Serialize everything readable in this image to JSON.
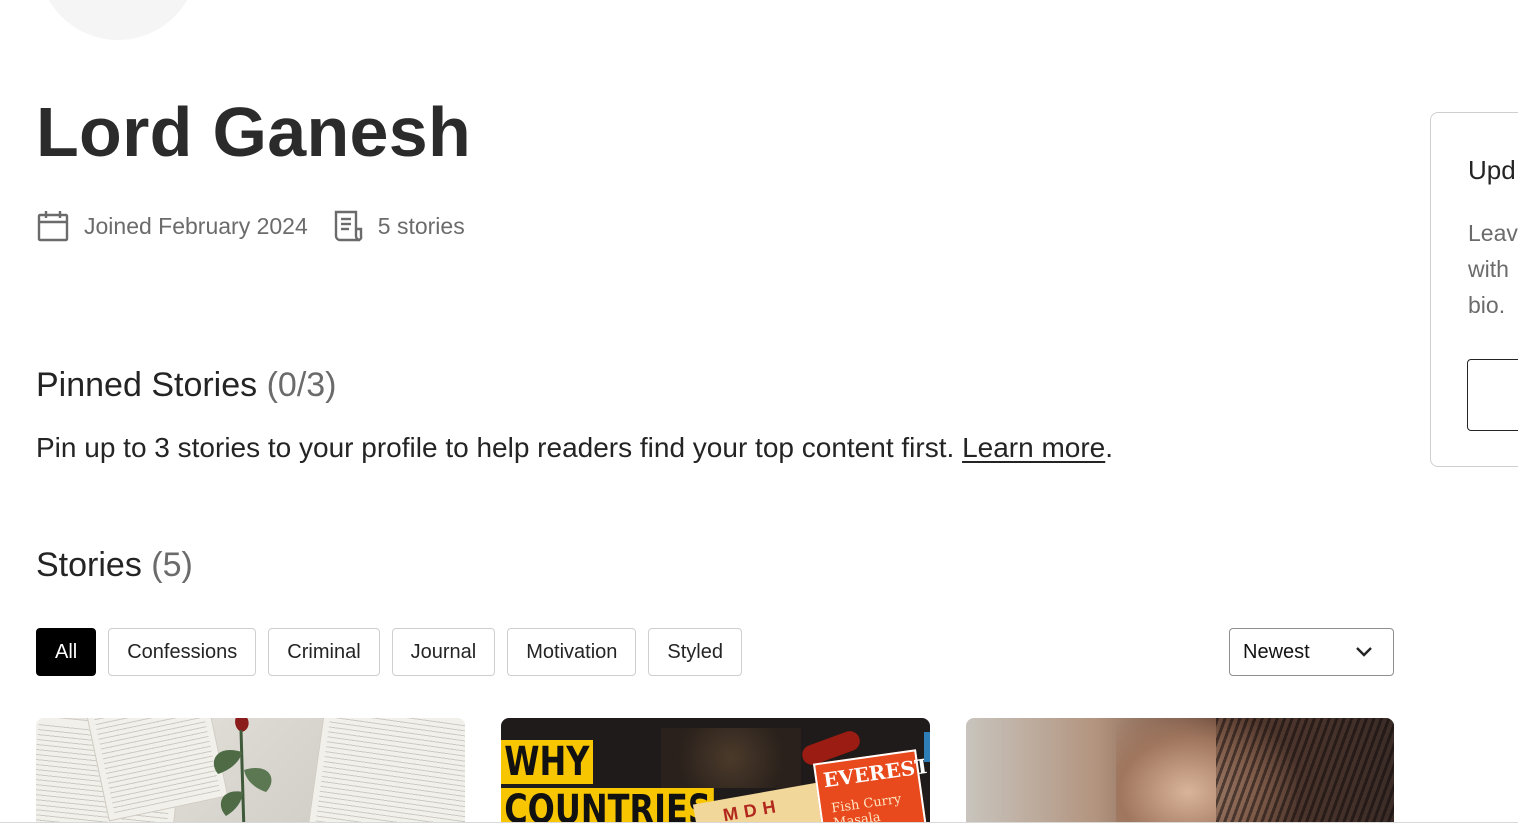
{
  "profile": {
    "name": "Lord Ganesh",
    "joined": "Joined February 2024",
    "stories_count": "5 stories"
  },
  "pinned": {
    "title": "Pinned Stories",
    "count": "(0/3)",
    "description": "Pin up to 3 stories to your profile to help readers find your top content first. ",
    "learn_more": "Learn more",
    "period": "."
  },
  "stories": {
    "title": "Stories",
    "count": "(5)",
    "filters": [
      "All",
      "Confessions",
      "Criminal",
      "Journal",
      "Motivation",
      "Styled"
    ],
    "active_filter": "All",
    "sort": {
      "selected": "Newest"
    }
  },
  "cards": [
    {
      "image": "rose-on-book-pages"
    },
    {
      "image": "spice-brands-thumbnail",
      "text_line1": "WHY",
      "text_line2": "COUNTRIES",
      "brand1": "EVEREST",
      "brand1_sub": "Fish Curry\nMasala",
      "brand2": "MDH"
    },
    {
      "image": "woman-hand-on-face"
    }
  ],
  "side_panel": {
    "title": "Upd",
    "body_lines": [
      "Leav",
      "with",
      "bio."
    ]
  },
  "colors": {
    "accent_active_chip": "#000000",
    "text_primary": "#242424",
    "text_secondary": "#6b6b6b",
    "border": "#cfcfcf",
    "spice_yellow": "#f7c600",
    "everest_orange": "#e8491d"
  },
  "icons": {
    "joined": "calendar-icon",
    "stories": "document-icon",
    "sort": "chevron-down-icon"
  }
}
